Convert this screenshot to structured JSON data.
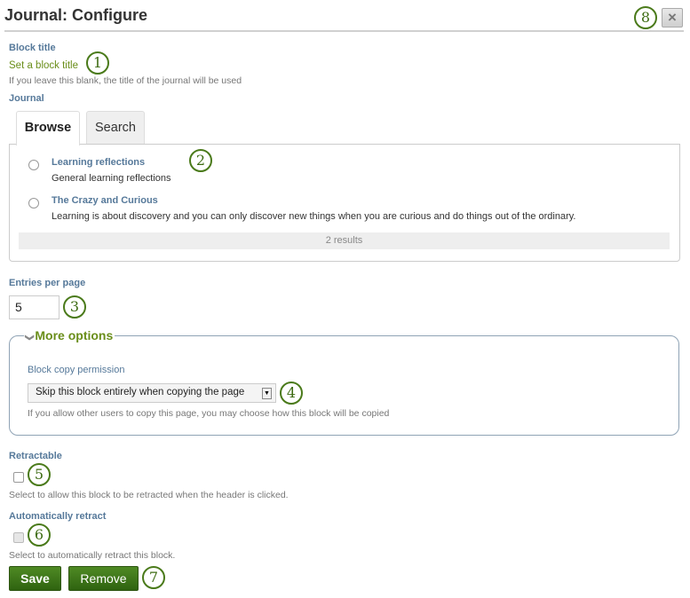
{
  "header": {
    "title": "Journal: Configure",
    "close_icon": "×"
  },
  "callouts": [
    "1",
    "2",
    "3",
    "4",
    "5",
    "6",
    "7",
    "8"
  ],
  "block_title": {
    "label": "Block title",
    "value": "Set a block title",
    "description": "If you leave this blank, the title of the journal will be used"
  },
  "journal": {
    "label": "Journal",
    "tabs": [
      {
        "label": "Browse",
        "active": true
      },
      {
        "label": "Search",
        "active": false
      }
    ],
    "items": [
      {
        "title": "Learning reflections",
        "description": "General learning reflections"
      },
      {
        "title": "The Crazy and Curious",
        "description": "Learning is about discovery and you can only discover new things when you are curious and do things out of the ordinary."
      }
    ],
    "results": "2 results"
  },
  "entries_per_page": {
    "label": "Entries per page",
    "value": "5"
  },
  "more_options": {
    "legend": "More options",
    "chevron_icon": "❯",
    "copy_permission": {
      "label": "Block copy permission",
      "selected": "Skip this block entirely when copying the page",
      "arrow_icon": "▼",
      "description": "If you allow other users to copy this page, you may choose how this block will be copied"
    }
  },
  "retractable": {
    "label": "Retractable",
    "checked": false,
    "description": "Select to allow this block to be retracted when the header is clicked."
  },
  "auto_retract": {
    "label": "Automatically retract",
    "checked": false,
    "disabled": true,
    "description": "Select to automatically retract this block."
  },
  "buttons": {
    "save": "Save",
    "remove": "Remove"
  }
}
